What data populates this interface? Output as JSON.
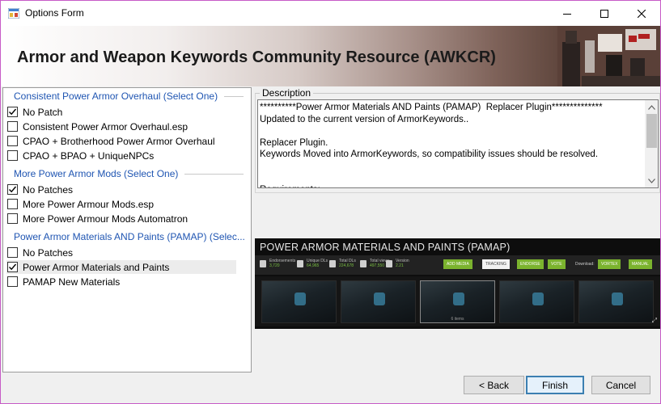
{
  "window": {
    "title": "Options Form",
    "border_color": "#c75bc7"
  },
  "banner": {
    "title": "Armor and Weapon Keywords Community Resource (AWKCR)"
  },
  "groups": [
    {
      "header": "Consistent Power Armor Overhaul (Select One)",
      "options": [
        {
          "label": "No Patch",
          "checked": true
        },
        {
          "label": "Consistent Power Armor Overhaul.esp",
          "checked": false
        },
        {
          "label": "CPAO + Brotherhood Power Armor Overhaul",
          "checked": false
        },
        {
          "label": "CPAO + BPAO + UniqueNPCs",
          "checked": false
        }
      ]
    },
    {
      "header": "More Power Armor Mods (Select One)",
      "options": [
        {
          "label": "No Patches",
          "checked": true
        },
        {
          "label": "More Power Armour Mods.esp",
          "checked": false
        },
        {
          "label": "More Power Armour Mods Automatron",
          "checked": false
        }
      ]
    },
    {
      "header": "Power Armor Materials AND Paints (PAMAP) (Selec...",
      "options": [
        {
          "label": "No Patches",
          "checked": false
        },
        {
          "label": "Power Armor Materials and Paints",
          "checked": true
        },
        {
          "label": "PAMAP New Materials",
          "checked": false
        }
      ]
    }
  ],
  "description": {
    "label": "Description",
    "text": "**********Power Armor Materials AND Paints (PAMAP)  Replacer Plugin**************\nUpdated to the current version of ArmorKeywords..\n\nReplacer Plugin.\nKeywords Moved into ArmorKeywords, so compatibility issues should be resolved.\n\n\nRequirements:"
  },
  "preview": {
    "title": "POWER ARMOR MATERIALS AND PAINTS (PAMAP)",
    "stats": [
      {
        "label": "Endorsements",
        "value": "3,720"
      },
      {
        "label": "Unique DLs",
        "value": "64,965"
      },
      {
        "label": "Total DLs",
        "value": "224,678"
      },
      {
        "label": "Total views",
        "value": "497,550"
      },
      {
        "label": "Version",
        "value": "2.21"
      }
    ],
    "buttons": {
      "add_media": "ADD MEDIA",
      "tracking": "TRACKING",
      "endorse": "ENDORSE",
      "vote": "VOTE",
      "download_label": "Download:",
      "vortex": "VORTEX",
      "manual": "MANUAL"
    },
    "items_count": "6 items",
    "accent_color": "#7bb32e"
  },
  "buttons": {
    "back": "< Back",
    "finish": "Finish",
    "cancel": "Cancel"
  }
}
